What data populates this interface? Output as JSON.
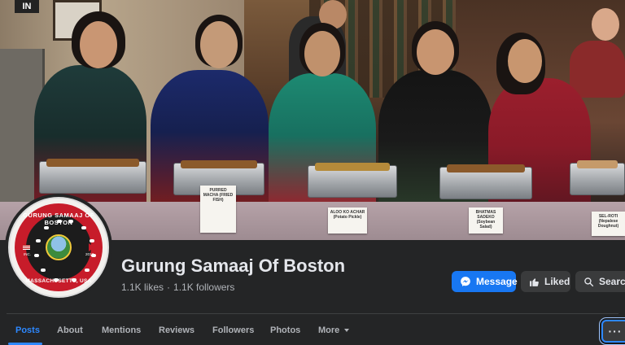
{
  "cover": {
    "wall_sign": "IN",
    "food_cards": [
      "PURRED MACHA (FRIED FISH)",
      "ALOO KO ACHAR (Potato Pickle)",
      "BHATMAS SADEKO (Soybean Salad)",
      "SEL-ROTI (Nepalese Doughnut)"
    ]
  },
  "avatar": {
    "top_text": "GURUNG SAMAAJ OF BOSTON",
    "bottom_text": "MASSACHUSETTS, USA",
    "inc_text": "INC.",
    "year_text": "2017"
  },
  "page": {
    "name": "Gurung Samaaj Of Boston",
    "likes": "1.1K likes",
    "separator": "·",
    "followers": "1.1K followers"
  },
  "actions": {
    "message": "Message",
    "liked": "Liked",
    "search": "Search"
  },
  "tabs": [
    {
      "label": "Posts"
    },
    {
      "label": "About"
    },
    {
      "label": "Mentions"
    },
    {
      "label": "Reviews"
    },
    {
      "label": "Followers"
    },
    {
      "label": "Photos"
    },
    {
      "label": "More"
    }
  ],
  "more_menu": {
    "label": "···"
  },
  "colors": {
    "accent": "#1877f2",
    "active_tab": "#2d88ff",
    "background": "#242526"
  }
}
